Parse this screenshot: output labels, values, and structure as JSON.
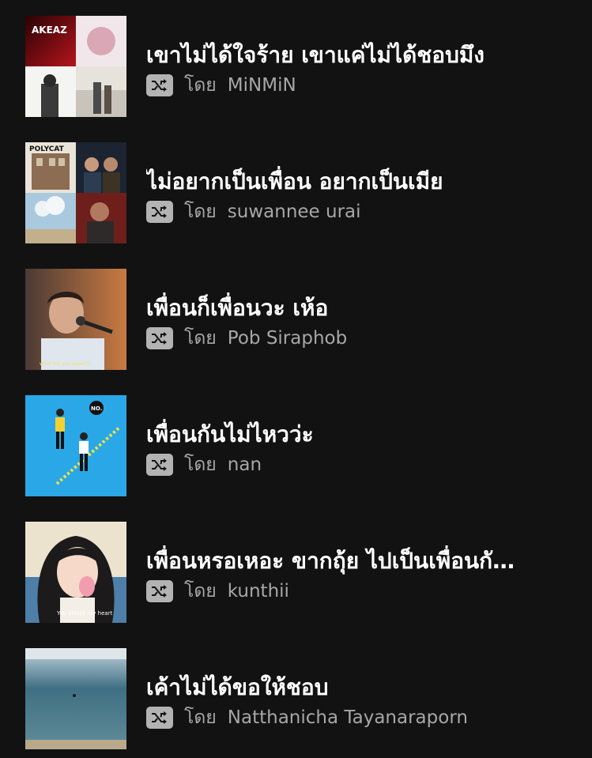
{
  "playlists": [
    {
      "title": "เขาไม่ได้ใจร้าย เขาแค่ไม่ได้ชอบมึง",
      "by": "โดย",
      "owner": "MiNMiN",
      "cover": "mosaic-a"
    },
    {
      "title": "ไม่อยากเป็นเพื่อน อยากเป็นเมีย",
      "by": "โดย",
      "owner": "suwannee urai",
      "cover": "mosaic-b"
    },
    {
      "title": "เพื่อนก็เพื่อนวะ เห้อ",
      "by": "โดย",
      "owner": "Pob Siraphob",
      "cover": "singer"
    },
    {
      "title": "เพื่อนกันไม่ไหวว่ะ",
      "by": "โดย",
      "owner": "nan",
      "cover": "blue-illustration"
    },
    {
      "title": "เพื่อนหรอเหอะ ขากถุ้ย ไปเป็นเพื่อนกั…",
      "by": "โดย",
      "owner": "kunthii",
      "cover": "girl-illustration"
    },
    {
      "title": "เค้าไม่ได้ขอให้ชอบ",
      "by": "โดย",
      "owner": "Natthanicha Tayanaraporn",
      "cover": "sea"
    }
  ],
  "cover_text": {
    "mosaic_a_left": "AKEAZ",
    "mosaic_b_band": "POLYCAT",
    "singer_caption": "what did you expect?",
    "blue_bubble": "NO.",
    "girl_caption": "You attack my heart"
  },
  "icons": {
    "shuffle": "shuffle-icon"
  }
}
